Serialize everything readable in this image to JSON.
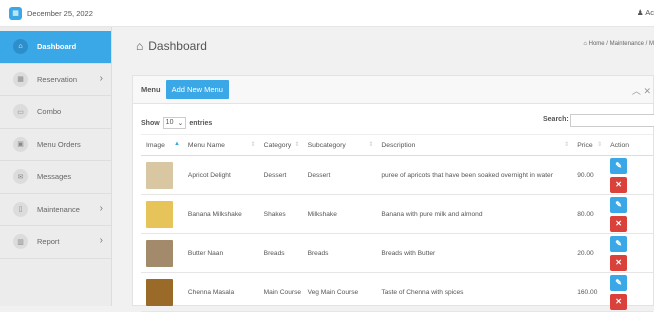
{
  "topbar": {
    "date": "December 25, 2022",
    "user": "Ac"
  },
  "sidebar": {
    "items": [
      {
        "label": "Dashboard",
        "icon": "home-icon",
        "glyph": "⌂",
        "chevron": ""
      },
      {
        "label": "Reservation",
        "icon": "calendar-icon",
        "glyph": "▦",
        "chevron": "›"
      },
      {
        "label": "Combo",
        "icon": "image-icon",
        "glyph": "▭",
        "chevron": ""
      },
      {
        "label": "Menu Orders",
        "icon": "list-icon",
        "glyph": "▣",
        "chevron": ""
      },
      {
        "label": "Messages",
        "icon": "envelope-icon",
        "glyph": "✉",
        "chevron": ""
      },
      {
        "label": "Maintenance",
        "icon": "file-icon",
        "glyph": "▯",
        "chevron": "›"
      },
      {
        "label": "Report",
        "icon": "chart-icon",
        "glyph": "▥",
        "chevron": "›"
      }
    ]
  },
  "page": {
    "title": "Dashboard",
    "breadcrumb": "Home / Maintenance / M"
  },
  "panel": {
    "title": "Menu",
    "add_button": "Add New Menu",
    "show_label": "Show",
    "entries_value": "10",
    "entries_label": "entries",
    "search_label": "Search:",
    "columns": [
      "Image",
      "Menu Name",
      "Category",
      "Subcategory",
      "Description",
      "Price",
      "Action"
    ],
    "rows": [
      {
        "name": "Apricot Delight",
        "category": "Dessert",
        "subcategory": "Dessert",
        "description": "puree of apricots that have been soaked overnight in water",
        "price": "90.00",
        "img": "#d8c7a2"
      },
      {
        "name": "Banana Milkshake",
        "category": "Shakes",
        "subcategory": "Milkshake",
        "description": "Banana with pure milk and almond",
        "price": "80.00",
        "img": "#e6c45a"
      },
      {
        "name": "Butter Naan",
        "category": "Breads",
        "subcategory": "Breads",
        "description": "Breads with Butter",
        "price": "20.00",
        "img": "#a38a6a"
      },
      {
        "name": "Chenna Masala",
        "category": "Main Course",
        "subcategory": "Veg Main Course",
        "description": "Taste of Chenna with spices",
        "price": "160.00",
        "img": "#9a6a28"
      }
    ]
  },
  "colors": {
    "accent": "#3aa8e6",
    "danger": "#d9413a"
  }
}
